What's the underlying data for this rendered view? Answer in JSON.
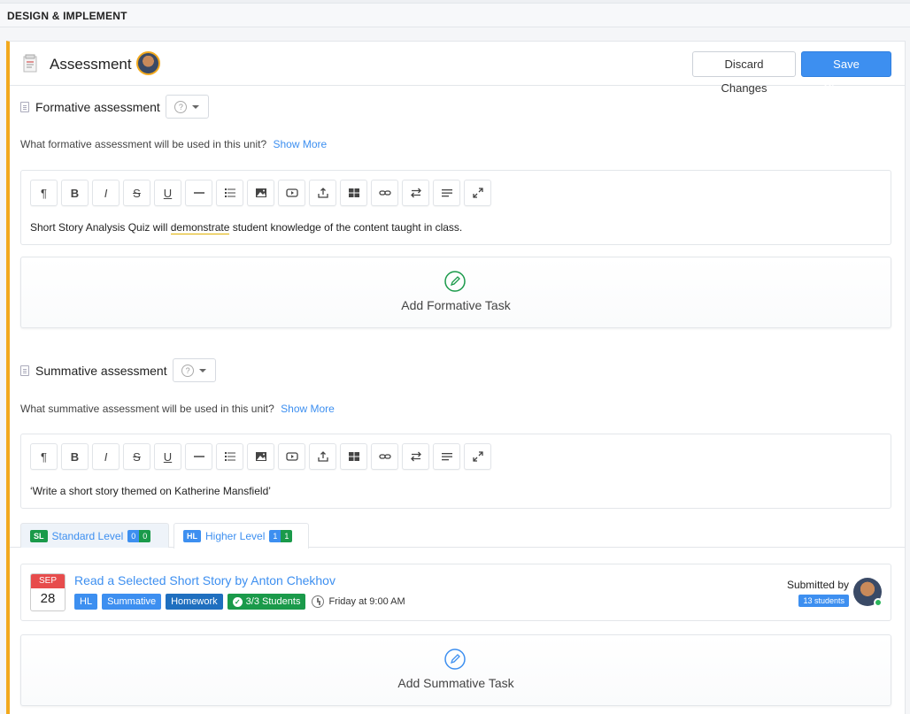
{
  "section": {
    "title": "DESIGN & IMPLEMENT"
  },
  "card": {
    "title": "Assessment",
    "discard_label": "Discard Changes",
    "save_label": "Save Changes"
  },
  "formative": {
    "label": "Formative assessment",
    "question": "What formative assessment will be used in this unit?",
    "show_more": "Show More",
    "text_before": "Short Story Analysis Quiz will ",
    "text_squiggle": "demonstrate",
    "text_after": " student knowledge of the content taught in class.",
    "add_task_label": "Add Formative Task"
  },
  "summative": {
    "label": "Summative assessment",
    "question": "What summative assessment will be used in this unit?",
    "show_more": "Show More",
    "text": "‘Write a short story themed on Katherine Mansfield’",
    "add_task_label": "Add Summative Task"
  },
  "tabs": {
    "sl": {
      "chip": "SL",
      "label": "Standard Level",
      "count_a": "0",
      "count_b": "0"
    },
    "hl": {
      "chip": "HL",
      "label": "Higher Level",
      "count_a": "1",
      "count_b": "1"
    }
  },
  "task": {
    "month": "SEP",
    "day": "28",
    "title": "Read a Selected Short Story by Anton Chekhov",
    "tags": {
      "level": "HL",
      "type": "Summative",
      "kind": "Homework",
      "students": "3/3 Students"
    },
    "due": "Friday at 9:00 AM",
    "submitted_by": "Submitted by",
    "students_badge": "13 students"
  },
  "toolbar_icons": [
    "paragraph-icon",
    "bold-icon",
    "italic-icon",
    "strikethrough-icon",
    "underline-icon",
    "horizontal-rule-icon",
    "list-icon",
    "image-icon",
    "video-icon",
    "upload-icon",
    "table-icon",
    "link-icon",
    "swap-icon",
    "align-icon",
    "expand-icon"
  ],
  "colors": {
    "accent": "#3d8ff0",
    "stripe": "#f2a91d",
    "success": "#1a9a4a",
    "calendar": "#e74c4c"
  }
}
